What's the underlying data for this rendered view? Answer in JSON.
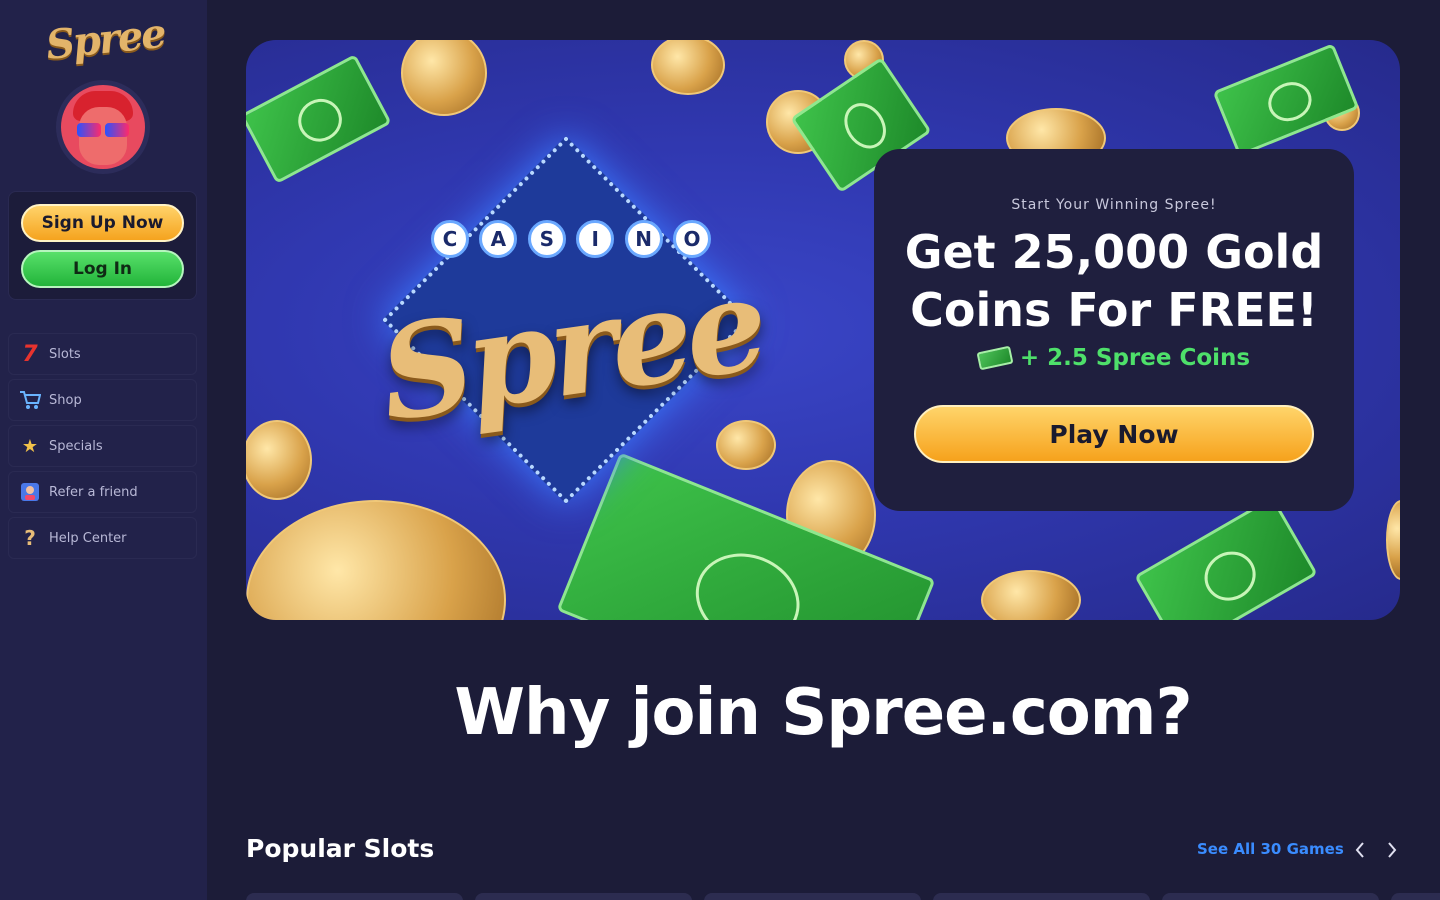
{
  "brand": {
    "logo_text": "Spree"
  },
  "sidebar": {
    "auth": {
      "signup_label": "Sign Up Now",
      "login_label": "Log In"
    },
    "items": [
      {
        "label": "Slots",
        "icon": "seven-icon"
      },
      {
        "label": "Shop",
        "icon": "cart-icon"
      },
      {
        "label": "Specials",
        "icon": "star-icon"
      },
      {
        "label": "Refer a friend",
        "icon": "refer-icon"
      },
      {
        "label": "Help Center",
        "icon": "question-icon"
      }
    ]
  },
  "hero": {
    "casino_letters": [
      "C",
      "A",
      "S",
      "I",
      "N",
      "O"
    ],
    "script_text": "Spree",
    "promo": {
      "tagline": "Start Your Winning Spree!",
      "title": "Get 25,000 Gold Coins For FREE!",
      "bonus": "+ 2.5 Spree Coins",
      "cta_label": "Play Now"
    }
  },
  "why_join": {
    "heading": "Why join Spree.com?"
  },
  "popular_slots": {
    "title": "Popular Slots",
    "see_all_label": "See All 30 Games",
    "prev_icon": "chevron-left-icon",
    "next_icon": "chevron-right-icon"
  },
  "colors": {
    "background": "#1c1c38",
    "sidebar": "#22224a",
    "accent_orange": "#f6a21c",
    "accent_green": "#22b43a",
    "link_blue": "#3a8cff"
  }
}
